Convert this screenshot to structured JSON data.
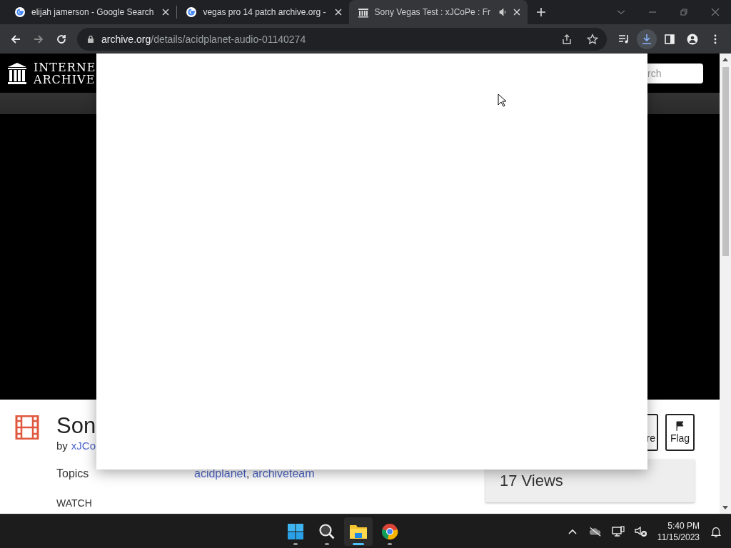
{
  "browser": {
    "tabs": [
      {
        "title": "elijah jamerson - Google Search",
        "kind": "google",
        "audio": false,
        "selected": false
      },
      {
        "title": "vegas pro 14 patch archive.org -",
        "kind": "google",
        "audio": false,
        "selected": false
      },
      {
        "title": "Sony Vegas Test : xJCoPe : Fr",
        "kind": "archive",
        "audio": true,
        "selected": true
      }
    ],
    "url": {
      "host": "archive.org",
      "path": "/details/acidplanet-audio-01140274"
    },
    "downloads_active": true
  },
  "page": {
    "logo": [
      "INTERNE",
      "ARCHIVE"
    ],
    "search_placeholder": "rch",
    "title": "Son",
    "byline": {
      "prefix": "by",
      "author": "xJCo"
    },
    "actions": [
      {
        "kind": "share",
        "label": "re"
      },
      {
        "kind": "flag",
        "label": "Flag"
      }
    ],
    "metadata": [
      {
        "label": "Topics",
        "links": [
          "acidplanet",
          "archiveteam"
        ],
        "separator": ","
      }
    ],
    "section": "WATCH",
    "views": "17 Views"
  },
  "taskbar": {
    "apps": [
      {
        "kind": "start",
        "active": false
      },
      {
        "kind": "search",
        "active": false
      },
      {
        "kind": "explorer",
        "active": true
      },
      {
        "kind": "chrome",
        "active": false
      }
    ],
    "time": "5:40 PM",
    "date": "11/15/2023"
  }
}
